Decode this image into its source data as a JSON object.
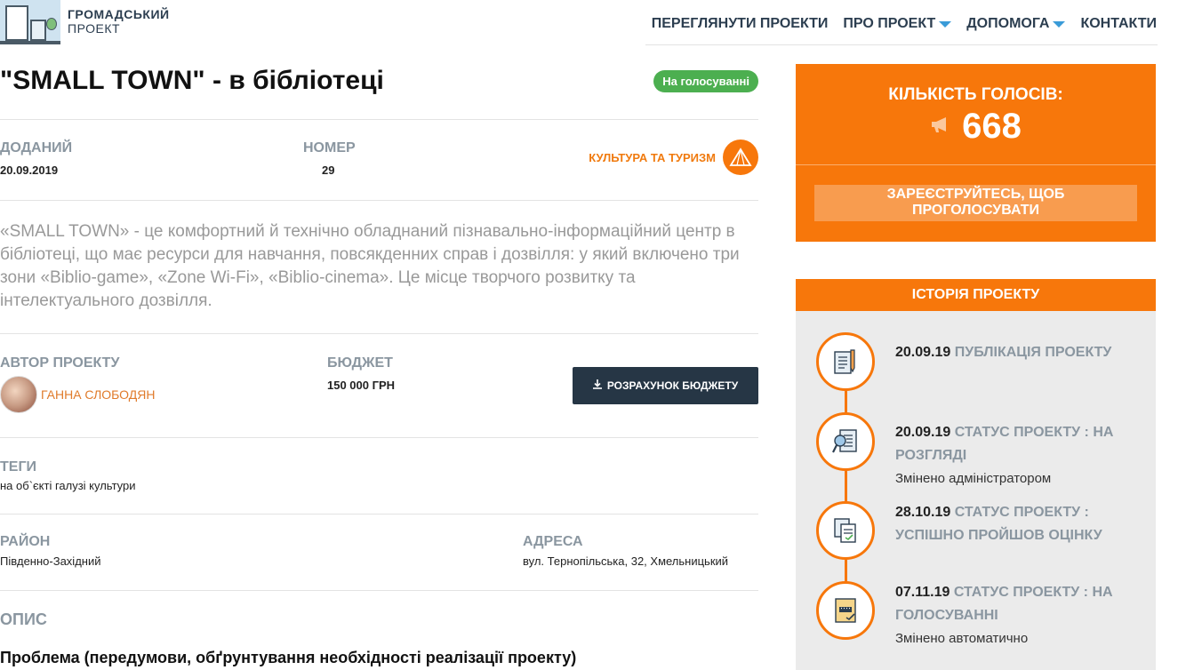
{
  "header": {
    "logo_line1": "ГРОМАДСЬКИЙ",
    "logo_line2": "ПРОЕКТ",
    "nav": [
      {
        "label": "ПЕРЕГЛЯНУТИ ПРОЕКТИ",
        "has_dropdown": false
      },
      {
        "label": "ПРО ПРОЕКТ",
        "has_dropdown": true
      },
      {
        "label": "ДОПОМОГА",
        "has_dropdown": true
      },
      {
        "label": "КОНТАКТИ",
        "has_dropdown": false
      }
    ]
  },
  "project": {
    "title": "\"SMALL TOWN\" - в бібліотеці",
    "status": "На голосуванні",
    "added_label": "ДОДАНИЙ",
    "added_value": "20.09.2019",
    "number_label": "НОМЕР",
    "number_value": "29",
    "category": "КУЛЬТУРА ТА ТУРИЗМ",
    "description": "«SMALL TOWN» - це комфортний й технічно обладнаний пізнавально-інформаційний центр в бібліотеці, що має ресурси для навчання, повсякденних справ і дозвілля: у який включено три зони «Biblio-game», «Zone Wi-Fi», «Biblio-cinema». Це місце творчого розвитку та інтелектуального дозвілля.",
    "author_label": "АВТОР ПРОЕКТУ",
    "author_name": "ГАННА СЛОБОДЯН",
    "budget_label": "БЮДЖЕТ",
    "budget_value": "150 000 ГРН",
    "budget_button": "РОЗРАХУНОК БЮДЖЕТУ",
    "tags_label": "ТЕГИ",
    "tags_value": "на об`єкті галузі культури",
    "district_label": "РАЙОН",
    "district_value": "Південно-Західний",
    "address_label": "АДРЕСА",
    "address_value": "вул. Тернопільська, 32, Хмельницький",
    "description_heading": "ОПИС",
    "problem_heading": "Проблема (передумови, обґрунтування необхідності реалізації проекту)"
  },
  "votes": {
    "label": "КІЛЬКІСТЬ ГОЛОСІВ:",
    "count": "668",
    "register_line1": "ЗАРЕЄСТРУЙТЕСЬ, ЩОБ",
    "register_line2": "ПРОГОЛОСУВАТИ"
  },
  "history": {
    "heading": "ІСТОРІЯ ПРОЕКТУ",
    "items": [
      {
        "date": "20.09.19",
        "status": "ПУБЛІКАЦІЯ ПРОЕКТУ",
        "sub": ""
      },
      {
        "date": "20.09.19",
        "status": "СТАТУС ПРОЕКТУ : НА РОЗГЛЯДІ",
        "sub": "Змінено адміністратором"
      },
      {
        "date": "28.10.19",
        "status": "СТАТУС ПРОЕКТУ : УСПІШНО ПРОЙШОВ ОЦІНКУ",
        "sub": ""
      },
      {
        "date": "07.11.19",
        "status": "СТАТУС ПРОЕКТУ : НА ГОЛОСУВАННІ",
        "sub": "Змінено автоматично"
      }
    ]
  },
  "colors": {
    "accent": "#f7770b",
    "badge_green": "#4caf50",
    "dark_button": "#263645"
  }
}
